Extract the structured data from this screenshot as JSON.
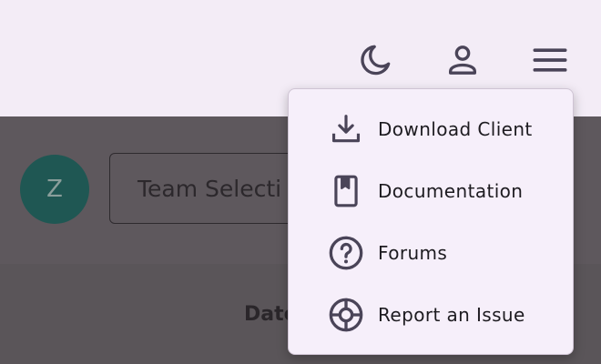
{
  "appbar": {
    "theme_toggle_icon": "moon-icon",
    "account_icon": "person-icon",
    "menu_icon": "hamburger-menu-icon"
  },
  "content": {
    "avatar_initial": "Z",
    "team_select_placeholder": "Team Selecti",
    "column_header": "Date"
  },
  "menu": {
    "items": [
      {
        "label": "Download Client",
        "icon": "download-icon"
      },
      {
        "label": "Documentation",
        "icon": "book-icon"
      },
      {
        "label": "Forums",
        "icon": "help-circle-icon"
      },
      {
        "label": "Report an Issue",
        "icon": "lifebuoy-icon"
      }
    ]
  },
  "colors": {
    "appbar_bg": "#f3ecf6",
    "menu_bg": "#f6effa",
    "icon": "#4a4458",
    "scrim_content": "#5a5559",
    "avatar_bg": "#1f5753"
  }
}
